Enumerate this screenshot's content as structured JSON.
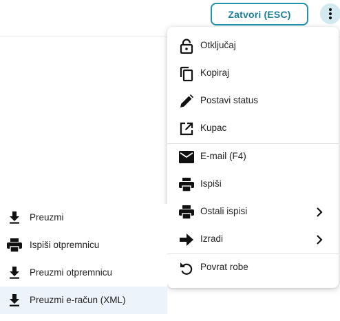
{
  "topbar": {
    "close_button_label": "Zatvori (ESC)",
    "more_button_icon": "more-vertical-icon"
  },
  "menu": {
    "items": [
      {
        "label": "Otključaj",
        "icon": "lock-open-icon"
      },
      {
        "label": "Kopiraj",
        "icon": "copy-icon"
      },
      {
        "label": "Postavi status",
        "icon": "pencil-icon"
      },
      {
        "label": "Kupac",
        "icon": "open-in-new-icon"
      },
      {
        "label": "E-mail (F4)",
        "icon": "mail-icon"
      },
      {
        "label": "Ispiši",
        "icon": "printer-icon"
      },
      {
        "label": "Ostali ispisi",
        "icon": "printer-icon",
        "submenu_icon": "chevron-right-icon"
      },
      {
        "label": "Izradi",
        "icon": "arrow-right-icon",
        "submenu_icon": "chevron-right-icon"
      },
      {
        "label": "Povrat robe",
        "icon": "undo-icon"
      }
    ]
  },
  "submenu": {
    "items": [
      {
        "label": "Preuzmi",
        "icon": "download-icon"
      },
      {
        "label": "Ispiši otpremnicu",
        "icon": "printer-icon"
      },
      {
        "label": "Preuzmi otpremnicu",
        "icon": "download-icon"
      },
      {
        "label": "Preuzmi e-račun (XML)",
        "icon": "download-icon",
        "highlighted": true
      }
    ]
  },
  "colors": {
    "accent": "#1f93ad",
    "accent_text": "#1a7f98",
    "kebab_bg": "#d3eaf1",
    "highlight_bg": "#edf3fa",
    "icon": "#111111"
  }
}
